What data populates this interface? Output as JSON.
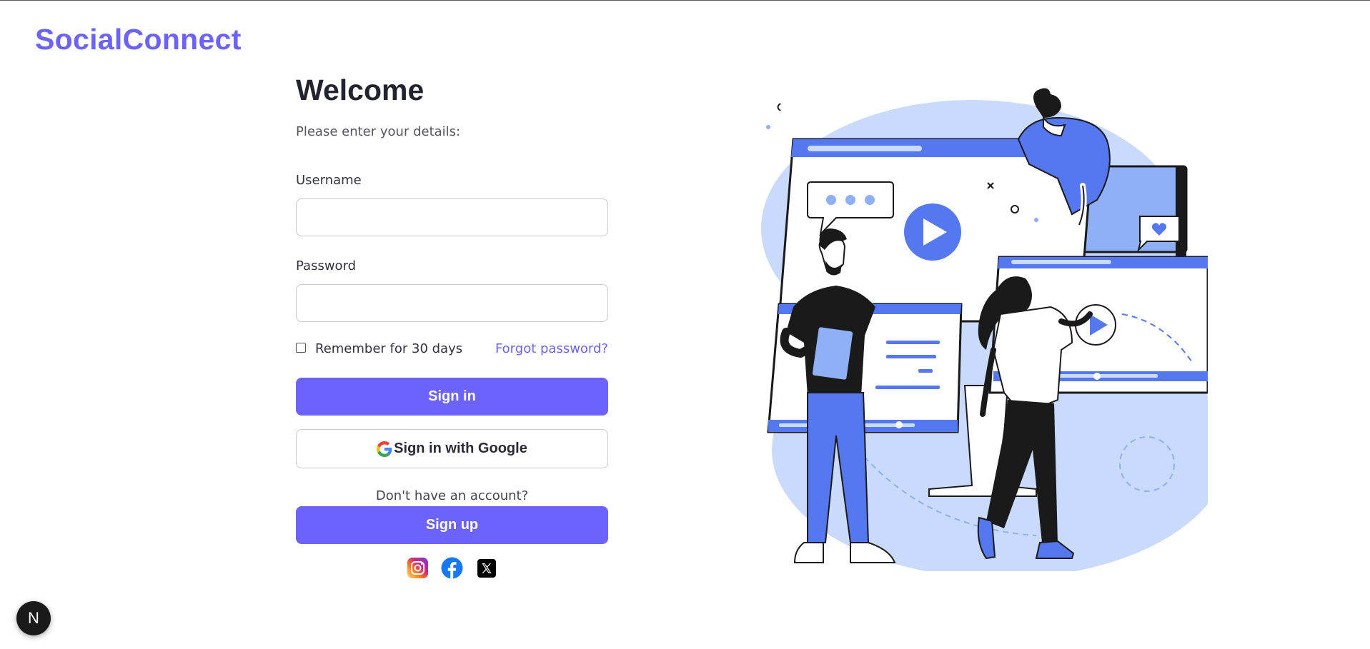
{
  "brand": "SocialConnect",
  "login": {
    "title": "Welcome",
    "subtitle": "Please enter your details:",
    "username_label": "Username",
    "password_label": "Password",
    "username_value": "",
    "password_value": "",
    "remember_label": "Remember for 30 days",
    "remember_checked": false,
    "forgot_label": "Forgot password?",
    "signin_label": "Sign in",
    "google_label": "Sign in with Google",
    "no_account_text": "Don't have an account?",
    "signup_label": "Sign up"
  },
  "socials": [
    {
      "name": "instagram-icon"
    },
    {
      "name": "facebook-icon"
    },
    {
      "name": "x-icon"
    }
  ],
  "dev_badge": {
    "label": "N"
  },
  "colors": {
    "accent": "#6c63ff",
    "illustration_blue": "#5578f0",
    "illustration_light": "#c9dafc"
  }
}
